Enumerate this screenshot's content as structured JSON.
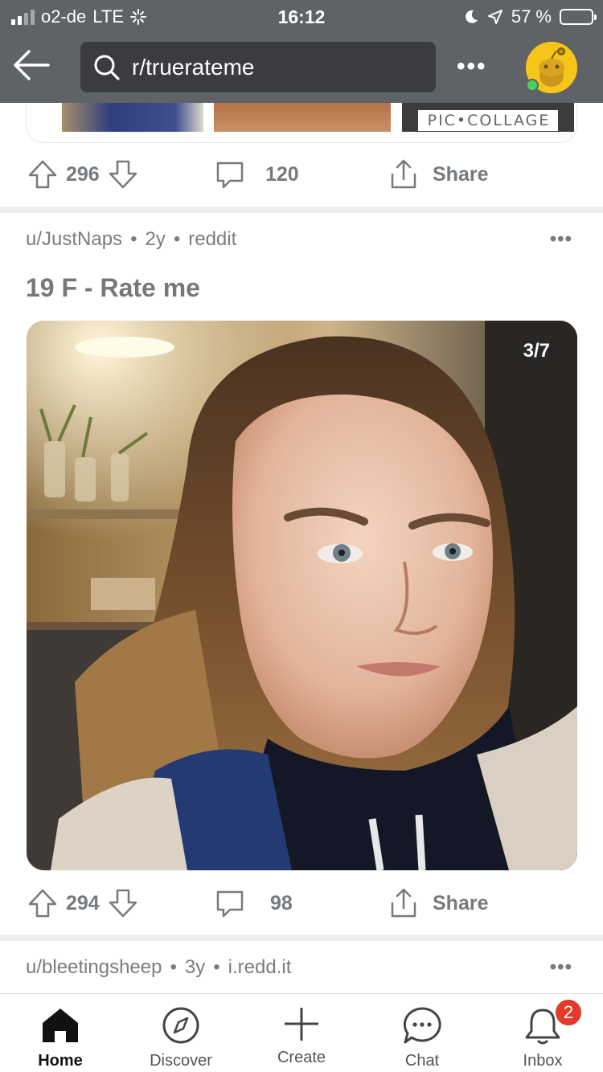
{
  "status_bar": {
    "carrier": "o2-de",
    "network": "LTE",
    "time": "16:12",
    "battery_percent": "57 %",
    "battery_level": 0.57,
    "icons": [
      "signal-bars-icon",
      "loading-spinner-icon",
      "moon-icon",
      "location-arrow-icon",
      "battery-icon"
    ]
  },
  "top_bar": {
    "search_text": "r/truerateme",
    "more_label": "•••",
    "icons": [
      "back-arrow-icon",
      "search-icon",
      "more-icon",
      "avatar-snoo-icon"
    ]
  },
  "previous_post": {
    "thumb_caption": "PIC•COLLAGE",
    "upvotes": "296",
    "comments": "120",
    "share_label": "Share"
  },
  "post": {
    "author": "u/JustNaps",
    "age": "2y",
    "source": "reddit",
    "separator": "•",
    "title": "19 F - Rate me",
    "gallery_counter": "3/7",
    "upvotes": "294",
    "comments": "98",
    "share_label": "Share",
    "more_label": "•••"
  },
  "next_post": {
    "author": "u/bleetingsheep",
    "age": "3y",
    "source": "i.redd.it",
    "separator": "•",
    "more_label": "•••"
  },
  "bottom_nav": {
    "items": [
      {
        "label": "Home",
        "icon": "home-icon",
        "active": true
      },
      {
        "label": "Discover",
        "icon": "compass-icon",
        "active": false
      },
      {
        "label": "Create",
        "icon": "plus-icon",
        "active": false
      },
      {
        "label": "Chat",
        "icon": "chat-bubble-icon",
        "active": false
      },
      {
        "label": "Inbox",
        "icon": "bell-icon",
        "active": false
      }
    ],
    "inbox_badge": "2"
  },
  "colors": {
    "topbar": "#5f6266",
    "search_bg": "#3a3c3f",
    "online": "#46d160",
    "badge": "#e03b2b",
    "avatar": "#f5c518"
  }
}
